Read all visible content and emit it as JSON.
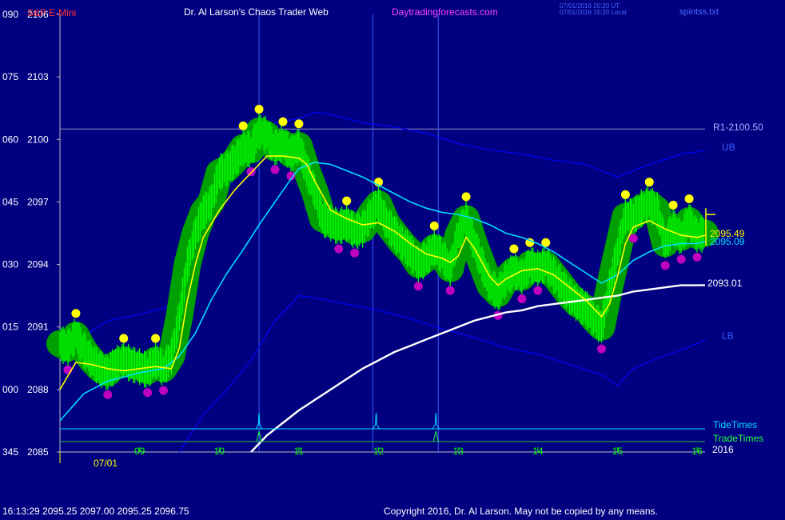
{
  "header": {
    "symbol": "S&P E-Mini",
    "author": "Dr. Al Larson's Chaos Trader Web",
    "site": "Daytradingforecasts.com",
    "stamp_utc": "07/01/2016 20:20 UT",
    "stamp_local": "07/01/2016 15:20 Local",
    "file": "spintss.txt"
  },
  "footer": {
    "quote": "16:13:29  2095.25 2097.00 2095.25 2096.75",
    "copyright": "Copyright 2016, Dr. Al Larson. May not be copied by any means."
  },
  "labels": {
    "r1": "R1-2100.50",
    "ub": "UB",
    "lb": "LB",
    "last_close": "2095.49",
    "fast_avg": "2095.09",
    "slow_avg": "2093.01",
    "tide": "TideTimes",
    "trade": "TradeTimes",
    "year": "2016",
    "date": "07/01"
  },
  "colors": {
    "background": "#000080",
    "price_bars": "#00ff00",
    "halo": "#00a000",
    "fast_ma": "#ffff00",
    "mid_ma": "#00e0ff",
    "slow_ma": "#ffffff",
    "bands": "#0000ff",
    "high_dots": "#ffff00",
    "low_dots": "#c000c0"
  },
  "chart_data": {
    "type": "line",
    "title": "S&P E-Mini",
    "y_ticks": [
      {
        "left": "090",
        "right": "2106"
      },
      {
        "left": "075",
        "right": "2103"
      },
      {
        "left": "060",
        "right": "2100"
      },
      {
        "left": "045",
        "right": "2097"
      },
      {
        "left": "030",
        "right": "2094"
      },
      {
        "left": "015",
        "right": "2091"
      },
      {
        "left": "000",
        "right": "2088"
      },
      {
        "left": "345",
        "right": "2085"
      }
    ],
    "ylim": [
      2085,
      2106
    ],
    "x_ticks": [
      "09",
      "10",
      "11",
      "12",
      "13",
      "14",
      "15",
      "16"
    ],
    "xlim": [
      8.0,
      16.1
    ],
    "r1_level": 2100.5,
    "event_lines": [
      10.5,
      11.93,
      12.75
    ],
    "tide_times": [
      10.5,
      11.97,
      12.72
    ],
    "trade_times": [
      10.5,
      12.72
    ],
    "series": [
      {
        "name": "price",
        "values": [
          [
            8.0,
            2090.2
          ],
          [
            8.1,
            2090.0
          ],
          [
            8.2,
            2090.6
          ],
          [
            8.3,
            2089.9
          ],
          [
            8.4,
            2089.4
          ],
          [
            8.5,
            2089.0
          ],
          [
            8.6,
            2088.8
          ],
          [
            8.7,
            2089.2
          ],
          [
            8.8,
            2089.4
          ],
          [
            8.9,
            2089.2
          ],
          [
            9.0,
            2089.1
          ],
          [
            9.1,
            2088.9
          ],
          [
            9.2,
            2089.4
          ],
          [
            9.3,
            2089.0
          ],
          [
            9.4,
            2089.6
          ],
          [
            9.5,
            2091.5
          ],
          [
            9.6,
            2094.0
          ],
          [
            9.7,
            2095.5
          ],
          [
            9.8,
            2096.5
          ],
          [
            9.9,
            2097.0
          ],
          [
            10.0,
            2098.4
          ],
          [
            10.1,
            2098.6
          ],
          [
            10.2,
            2099.0
          ],
          [
            10.3,
            2099.6
          ],
          [
            10.4,
            2099.5
          ],
          [
            10.5,
            2100.4
          ],
          [
            10.6,
            2100.2
          ],
          [
            10.7,
            2099.6
          ],
          [
            10.8,
            2099.8
          ],
          [
            10.9,
            2099.3
          ],
          [
            11.0,
            2099.7
          ],
          [
            11.1,
            2098.5
          ],
          [
            11.2,
            2097.5
          ],
          [
            11.3,
            2096.2
          ],
          [
            11.4,
            2096.0
          ],
          [
            11.5,
            2095.8
          ],
          [
            11.6,
            2096.0
          ],
          [
            11.7,
            2095.6
          ],
          [
            11.8,
            2095.7
          ],
          [
            11.9,
            2096.4
          ],
          [
            12.0,
            2096.9
          ],
          [
            12.1,
            2096.0
          ],
          [
            12.2,
            2095.5
          ],
          [
            12.3,
            2095.0
          ],
          [
            12.4,
            2094.6
          ],
          [
            12.5,
            2094.0
          ],
          [
            12.6,
            2094.3
          ],
          [
            12.7,
            2094.8
          ],
          [
            12.8,
            2094.4
          ],
          [
            12.9,
            2093.8
          ],
          [
            13.0,
            2095.4
          ],
          [
            13.1,
            2096.2
          ],
          [
            13.2,
            2095.0
          ],
          [
            13.3,
            2094.0
          ],
          [
            13.4,
            2093.0
          ],
          [
            13.5,
            2092.6
          ],
          [
            13.6,
            2093.3
          ],
          [
            13.7,
            2093.7
          ],
          [
            13.8,
            2093.4
          ],
          [
            13.9,
            2094.0
          ],
          [
            14.0,
            2093.8
          ],
          [
            14.1,
            2094.0
          ],
          [
            14.2,
            2093.5
          ],
          [
            14.3,
            2093.0
          ],
          [
            14.4,
            2092.5
          ],
          [
            14.5,
            2092.1
          ],
          [
            14.6,
            2091.9
          ],
          [
            14.7,
            2091.4
          ],
          [
            14.8,
            2091.0
          ],
          [
            14.9,
            2092.9
          ],
          [
            15.0,
            2094.6
          ],
          [
            15.1,
            2096.3
          ],
          [
            15.2,
            2096.3
          ],
          [
            15.3,
            2096.7
          ],
          [
            15.4,
            2096.9
          ],
          [
            15.5,
            2096.6
          ],
          [
            15.6,
            2095.0
          ],
          [
            15.7,
            2095.8
          ],
          [
            15.8,
            2095.3
          ],
          [
            15.9,
            2096.1
          ],
          [
            16.0,
            2095.4
          ],
          [
            16.1,
            2095.5
          ]
        ]
      },
      {
        "name": "fast",
        "values": [
          [
            8.0,
            2088.0
          ],
          [
            8.2,
            2089.3
          ],
          [
            8.4,
            2089.2
          ],
          [
            8.6,
            2089.0
          ],
          [
            8.8,
            2088.9
          ],
          [
            9.0,
            2089.0
          ],
          [
            9.2,
            2089.1
          ],
          [
            9.4,
            2089.0
          ],
          [
            9.5,
            2090.0
          ],
          [
            9.6,
            2092.3
          ],
          [
            9.7,
            2094.0
          ],
          [
            9.8,
            2095.3
          ],
          [
            10.0,
            2096.6
          ],
          [
            10.2,
            2097.6
          ],
          [
            10.4,
            2098.4
          ],
          [
            10.6,
            2099.2
          ],
          [
            10.8,
            2099.2
          ],
          [
            11.0,
            2099.1
          ],
          [
            11.1,
            2098.8
          ],
          [
            11.2,
            2098.0
          ],
          [
            11.3,
            2097.3
          ],
          [
            11.4,
            2096.6
          ],
          [
            11.6,
            2096.2
          ],
          [
            11.8,
            2095.9
          ],
          [
            12.0,
            2096.0
          ],
          [
            12.2,
            2095.6
          ],
          [
            12.4,
            2095.0
          ],
          [
            12.6,
            2094.5
          ],
          [
            12.8,
            2094.3
          ],
          [
            12.9,
            2094.1
          ],
          [
            13.0,
            2094.4
          ],
          [
            13.1,
            2095.3
          ],
          [
            13.2,
            2094.8
          ],
          [
            13.4,
            2093.4
          ],
          [
            13.5,
            2093.0
          ],
          [
            13.6,
            2093.3
          ],
          [
            13.8,
            2093.7
          ],
          [
            14.0,
            2093.8
          ],
          [
            14.2,
            2093.5
          ],
          [
            14.4,
            2092.9
          ],
          [
            14.6,
            2092.3
          ],
          [
            14.8,
            2091.5
          ],
          [
            14.9,
            2092.1
          ],
          [
            15.0,
            2093.4
          ],
          [
            15.1,
            2095.0
          ],
          [
            15.2,
            2095.8
          ],
          [
            15.4,
            2096.1
          ],
          [
            15.6,
            2095.7
          ],
          [
            15.8,
            2095.4
          ],
          [
            16.0,
            2095.3
          ],
          [
            16.1,
            2095.4
          ]
        ]
      },
      {
        "name": "mid",
        "values": [
          [
            8.0,
            2086.5
          ],
          [
            8.3,
            2087.8
          ],
          [
            8.6,
            2088.4
          ],
          [
            9.0,
            2088.8
          ],
          [
            9.3,
            2089.0
          ],
          [
            9.5,
            2089.6
          ],
          [
            9.7,
            2090.7
          ],
          [
            9.9,
            2092.3
          ],
          [
            10.1,
            2093.6
          ],
          [
            10.3,
            2094.7
          ],
          [
            10.5,
            2095.9
          ],
          [
            10.7,
            2097.0
          ],
          [
            10.9,
            2098.1
          ],
          [
            11.0,
            2098.6
          ],
          [
            11.2,
            2098.9
          ],
          [
            11.4,
            2098.8
          ],
          [
            11.6,
            2098.5
          ],
          [
            11.8,
            2098.2
          ],
          [
            12.0,
            2097.8
          ],
          [
            12.2,
            2097.4
          ],
          [
            12.4,
            2097.0
          ],
          [
            12.6,
            2096.7
          ],
          [
            12.8,
            2096.5
          ],
          [
            13.0,
            2096.4
          ],
          [
            13.2,
            2096.2
          ],
          [
            13.4,
            2095.9
          ],
          [
            13.6,
            2095.5
          ],
          [
            13.8,
            2095.3
          ],
          [
            14.0,
            2095.0
          ],
          [
            14.2,
            2094.6
          ],
          [
            14.4,
            2094.1
          ],
          [
            14.6,
            2093.6
          ],
          [
            14.8,
            2093.1
          ],
          [
            15.0,
            2093.5
          ],
          [
            15.2,
            2094.2
          ],
          [
            15.4,
            2094.6
          ],
          [
            15.6,
            2094.9
          ],
          [
            15.8,
            2095.0
          ],
          [
            16.0,
            2095.0
          ],
          [
            16.1,
            2095.1
          ]
        ]
      },
      {
        "name": "slow",
        "values": [
          [
            10.4,
            2085.0
          ],
          [
            10.6,
            2085.8
          ],
          [
            10.8,
            2086.4
          ],
          [
            11.0,
            2087.0
          ],
          [
            11.2,
            2087.5
          ],
          [
            11.4,
            2088.0
          ],
          [
            11.6,
            2088.5
          ],
          [
            11.8,
            2089.0
          ],
          [
            12.0,
            2089.4
          ],
          [
            12.2,
            2089.8
          ],
          [
            12.4,
            2090.1
          ],
          [
            12.6,
            2090.4
          ],
          [
            12.8,
            2090.7
          ],
          [
            13.0,
            2091.0
          ],
          [
            13.2,
            2091.3
          ],
          [
            13.4,
            2091.5
          ],
          [
            13.6,
            2091.7
          ],
          [
            13.8,
            2091.8
          ],
          [
            14.0,
            2092.0
          ],
          [
            14.2,
            2092.1
          ],
          [
            14.4,
            2092.2
          ],
          [
            14.6,
            2092.3
          ],
          [
            14.8,
            2092.4
          ],
          [
            15.0,
            2092.5
          ],
          [
            15.2,
            2092.7
          ],
          [
            15.4,
            2092.8
          ],
          [
            15.6,
            2092.9
          ],
          [
            15.8,
            2093.0
          ],
          [
            16.0,
            2093.0
          ],
          [
            16.1,
            2093.01
          ]
        ]
      },
      {
        "name": "upper_band",
        "values": [
          [
            8.2,
            2090.3
          ],
          [
            8.6,
            2091.3
          ],
          [
            9.0,
            2091.6
          ],
          [
            9.4,
            2092.0
          ],
          [
            9.7,
            2094.8
          ],
          [
            10.0,
            2097.0
          ],
          [
            10.4,
            2099.5
          ],
          [
            10.7,
            2100.8
          ],
          [
            11.0,
            2101.0
          ],
          [
            11.2,
            2101.3
          ],
          [
            11.4,
            2101.2
          ],
          [
            11.8,
            2100.8
          ],
          [
            12.2,
            2100.6
          ],
          [
            12.6,
            2100.3
          ],
          [
            13.0,
            2099.8
          ],
          [
            13.4,
            2099.5
          ],
          [
            13.8,
            2099.3
          ],
          [
            14.2,
            2099.0
          ],
          [
            14.6,
            2098.8
          ],
          [
            15.0,
            2098.2
          ],
          [
            15.4,
            2098.8
          ],
          [
            15.8,
            2099.3
          ],
          [
            16.0,
            2099.4
          ],
          [
            16.1,
            2099.5
          ]
        ]
      },
      {
        "name": "lower_band",
        "values": [
          [
            9.5,
            2085.0
          ],
          [
            9.8,
            2086.8
          ],
          [
            10.1,
            2088.0
          ],
          [
            10.4,
            2089.4
          ],
          [
            10.7,
            2091.3
          ],
          [
            11.0,
            2092.5
          ],
          [
            11.2,
            2092.4
          ],
          [
            11.6,
            2092.1
          ],
          [
            12.0,
            2091.8
          ],
          [
            12.4,
            2091.4
          ],
          [
            12.8,
            2090.9
          ],
          [
            13.2,
            2090.5
          ],
          [
            13.6,
            2090.0
          ],
          [
            14.0,
            2089.7
          ],
          [
            14.4,
            2089.2
          ],
          [
            14.8,
            2088.7
          ],
          [
            15.0,
            2088.2
          ],
          [
            15.2,
            2089.0
          ],
          [
            15.5,
            2089.5
          ],
          [
            15.8,
            2089.9
          ],
          [
            16.0,
            2090.2
          ],
          [
            16.1,
            2090.4
          ]
        ]
      }
    ]
  }
}
